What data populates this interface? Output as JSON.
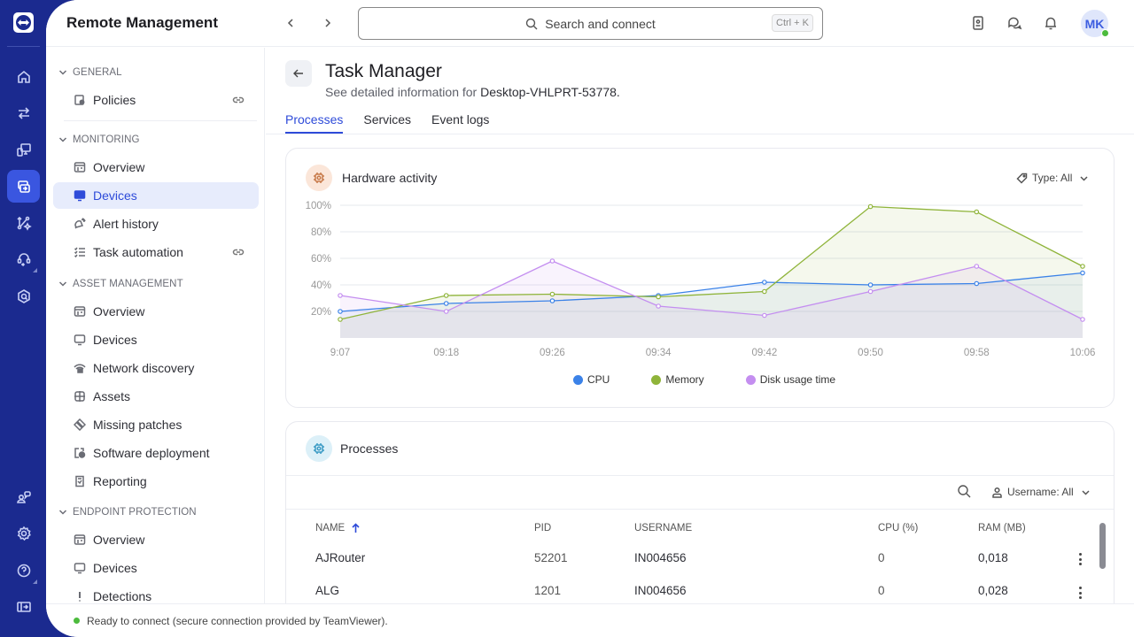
{
  "app": {
    "title": "Remote Management",
    "search_placeholder": "Search and connect",
    "search_shortcut": "Ctrl + K",
    "user_initials": "MK",
    "status_text": "Ready to connect (secure connection provided by TeamViewer)."
  },
  "rail": {
    "items": [
      {
        "icon": "home-icon"
      },
      {
        "icon": "transfer-icon"
      },
      {
        "icon": "devices-icon"
      },
      {
        "icon": "remote-management-icon",
        "active": true
      },
      {
        "icon": "integrations-icon"
      },
      {
        "icon": "support-headset-icon"
      },
      {
        "icon": "security-shield-icon"
      },
      {
        "icon": "community-icon"
      },
      {
        "icon": "settings-icon"
      },
      {
        "icon": "help-icon"
      },
      {
        "icon": "expand-panel-icon"
      }
    ]
  },
  "sidebar": {
    "sections": [
      {
        "title": "GENERAL",
        "items": [
          {
            "label": "Policies",
            "icon": "policies-icon",
            "link": true
          }
        ]
      },
      {
        "title": "MONITORING",
        "items": [
          {
            "label": "Overview",
            "icon": "overview-icon"
          },
          {
            "label": "Devices",
            "icon": "monitor-icon",
            "active": true
          },
          {
            "label": "Alert history",
            "icon": "alert-icon"
          },
          {
            "label": "Task automation",
            "icon": "task-list-icon",
            "link": true
          }
        ]
      },
      {
        "title": "ASSET MANAGEMENT",
        "items": [
          {
            "label": "Overview",
            "icon": "overview-icon"
          },
          {
            "label": "Devices",
            "icon": "monitor-icon"
          },
          {
            "label": "Network discovery",
            "icon": "network-icon"
          },
          {
            "label": "Assets",
            "icon": "assets-icon"
          },
          {
            "label": "Missing patches",
            "icon": "patches-icon"
          },
          {
            "label": "Software deployment",
            "icon": "deployment-icon"
          },
          {
            "label": "Reporting",
            "icon": "reporting-icon"
          }
        ]
      },
      {
        "title": "ENDPOINT PROTECTION",
        "items": [
          {
            "label": "Overview",
            "icon": "overview-icon"
          },
          {
            "label": "Devices",
            "icon": "monitor-icon"
          },
          {
            "label": "Detections",
            "icon": "detections-icon"
          }
        ]
      }
    ]
  },
  "page": {
    "title": "Task Manager",
    "subtitle_prefix": "See detailed information for ",
    "device_name": "Desktop-VHLPRT-53778.",
    "tabs": [
      {
        "label": "Processes",
        "active": true
      },
      {
        "label": "Services"
      },
      {
        "label": "Event logs"
      }
    ]
  },
  "hardware_card": {
    "title": "Hardware activity",
    "filter_label": "Type: All"
  },
  "chart_data": {
    "type": "area",
    "title": "Hardware activity",
    "xlabel": "",
    "ylabel": "",
    "x": [
      "9:07",
      "09:18",
      "09:26",
      "09:34",
      "09:42",
      "09:50",
      "09:58",
      "10:06"
    ],
    "yticks": [
      "20%",
      "40%",
      "60%",
      "80%",
      "100%"
    ],
    "ylim": [
      0,
      100
    ],
    "grid": true,
    "legend_position": "bottom-center",
    "series": [
      {
        "name": "CPU",
        "color": "#3b82e8",
        "values": [
          20,
          26,
          28,
          32,
          42,
          40,
          41,
          49
        ]
      },
      {
        "name": "Memory",
        "color": "#8fb43a",
        "values": [
          14,
          32,
          33,
          31,
          35,
          99,
          95,
          54
        ]
      },
      {
        "name": "Disk usage time",
        "color": "#c48ef0",
        "values": [
          32,
          20,
          58,
          24,
          17,
          35,
          54,
          14
        ]
      }
    ]
  },
  "processes_card": {
    "title": "Processes",
    "filter_label": "Username: All",
    "columns": [
      "NAME",
      "PID",
      "USERNAME",
      "CPU (%)",
      "RAM (MB)"
    ],
    "rows": [
      {
        "name": "AJRouter",
        "pid": "52201",
        "username": "IN004656",
        "cpu": "0",
        "ram": "0,018"
      },
      {
        "name": "ALG",
        "pid": "1201",
        "username": "IN004656",
        "cpu": "0",
        "ram": "0,028"
      }
    ]
  }
}
